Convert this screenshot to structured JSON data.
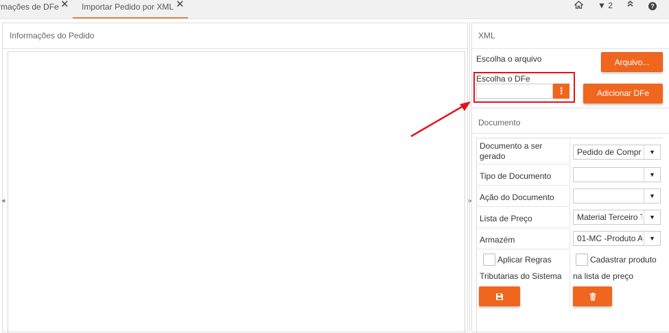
{
  "tabs": [
    {
      "label": "rmações de DFe",
      "close": "✕"
    },
    {
      "label": "Importar Pedido por XML",
      "close": "✕"
    }
  ],
  "toolbar": {
    "home_icon": "home-icon",
    "dropdown_count": "2",
    "collapse_icon": "chevron-up-double-icon",
    "help_icon": "help-icon",
    "help_glyph": "?"
  },
  "left_panel": {
    "title": "Informações do Pedido"
  },
  "xml_panel": {
    "title": "XML",
    "choose_file_label": "Escolha o arquivo",
    "file_button": "Arquivo...",
    "choose_dfe_label": "Escolha o DFe",
    "dfe_value": "",
    "dfe_button_glyph": "⋮",
    "add_dfe_button": "Adicionar DFe"
  },
  "document_panel": {
    "title": "Documento",
    "fields": [
      {
        "label": "Documento a ser gerado",
        "value": "Pedido de Compr"
      },
      {
        "label": "Tipo de Documento",
        "value": ""
      },
      {
        "label": "Ação do Documento",
        "value": ""
      },
      {
        "label": "Lista de Preço",
        "value": "Material Terceiro T"
      },
      {
        "label": "Armazém",
        "value": "01-MC -Produto A"
      }
    ],
    "checkbox_rules": {
      "label_line1": "Aplicar Regras",
      "label_line2": "Tributarias do Sistema",
      "checked": false
    },
    "checkbox_register": {
      "label_line1": "Cadastrar produto",
      "label_line2": "na lista de preço",
      "checked": false
    },
    "save_icon": "save-icon",
    "trash_icon": "trash-icon"
  },
  "colors": {
    "accent": "#f0661e",
    "highlight": "#e3121a",
    "tab_underline": "#e8834a"
  }
}
